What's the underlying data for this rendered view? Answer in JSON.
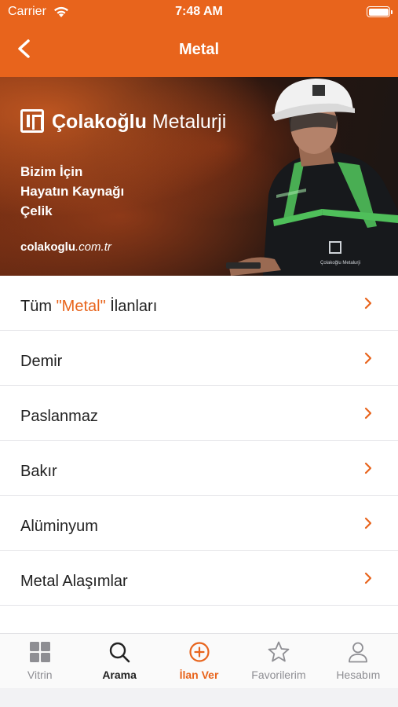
{
  "status_bar": {
    "carrier": "Carrier",
    "time": "7:48 AM"
  },
  "nav": {
    "title": "Metal"
  },
  "banner": {
    "brand_bold": "Çolakoğlu",
    "brand_light": " Metalurji",
    "tagline_lines": [
      "Bizim İçin",
      "Hayatın Kaynağı",
      "Çelik"
    ],
    "site_bold": "colakoglu",
    "site_light": ".com.tr",
    "vest_text": "Çolakoğlu Metalurji"
  },
  "categories": [
    {
      "prefix": "Tüm ",
      "highlight": "\"Metal\"",
      "suffix": " İlanları"
    },
    {
      "prefix": "Demir"
    },
    {
      "prefix": "Paslanmaz"
    },
    {
      "prefix": "Bakır"
    },
    {
      "prefix": "Alüminyum"
    },
    {
      "prefix": "Metal Alaşımlar"
    }
  ],
  "tabs": [
    {
      "label": "Vitrin",
      "icon": "grid-icon"
    },
    {
      "label": "Arama",
      "icon": "search-icon"
    },
    {
      "label": "İlan Ver",
      "icon": "add-circle-icon"
    },
    {
      "label": "Favorilerim",
      "icon": "star-icon"
    },
    {
      "label": "Hesabım",
      "icon": "person-icon"
    }
  ],
  "colors": {
    "accent": "#e8641c",
    "text": "#222222",
    "muted": "#8e8e93"
  }
}
